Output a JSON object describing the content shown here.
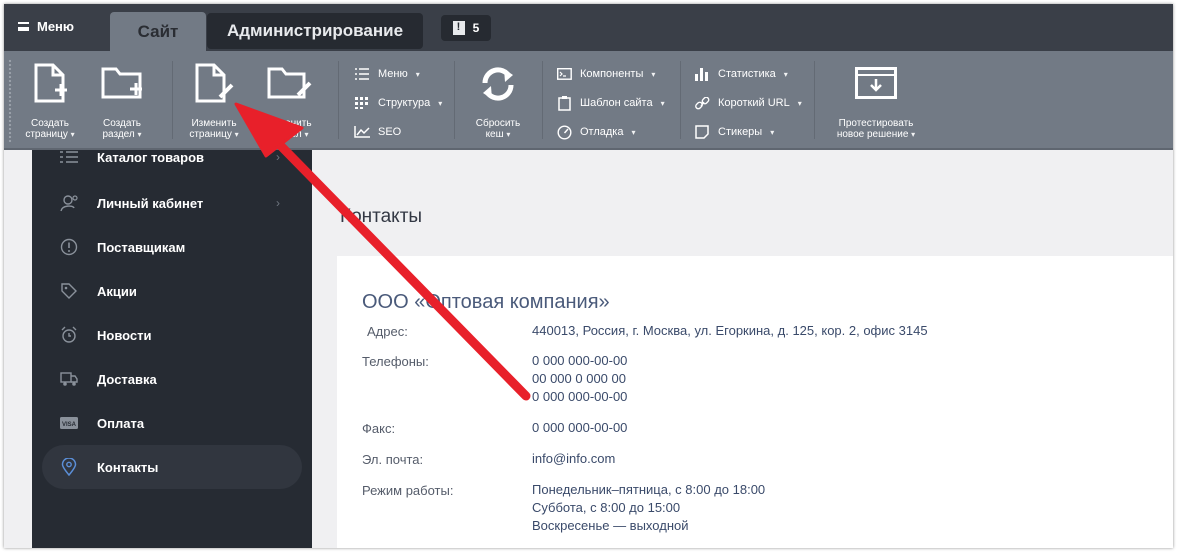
{
  "topbar": {
    "menu_label": "Меню",
    "tabs": [
      {
        "label": "Сайт",
        "active": true
      },
      {
        "label": "Администрирование",
        "active": false
      }
    ],
    "notifications_count": "5"
  },
  "toolbar": {
    "big_buttons": [
      {
        "line1": "Создать",
        "line2": "страницу",
        "icon": "create-page-icon"
      },
      {
        "line1": "Создать",
        "line2": "раздел",
        "icon": "create-section-icon"
      },
      {
        "line1": "Изменить",
        "line2": "страницу",
        "icon": "edit-page-icon"
      },
      {
        "line1": "Изменить",
        "line2": "раздел",
        "icon": "edit-section-icon"
      },
      {
        "line1": "Сбросить",
        "line2": "кеш",
        "icon": "refresh-icon"
      },
      {
        "line1": "Протестировать",
        "line2": "новое решение",
        "icon": "download-window-icon"
      }
    ],
    "group1": [
      {
        "label": "Меню",
        "icon": "list-icon",
        "has_caret": true
      },
      {
        "label": "Структура",
        "icon": "grid-icon",
        "has_caret": true
      },
      {
        "label": "SEO",
        "icon": "chart-icon",
        "has_caret": false
      }
    ],
    "group2": [
      {
        "label": "Компоненты",
        "icon": "terminal-icon"
      },
      {
        "label": "Шаблон сайта",
        "icon": "clipboard-icon"
      },
      {
        "label": "Отладка",
        "icon": "gauge-icon"
      }
    ],
    "group3": [
      {
        "label": "Статистика",
        "icon": "bar-chart-icon"
      },
      {
        "label": "Короткий URL",
        "icon": "link-icon"
      },
      {
        "label": "Стикеры",
        "icon": "sticker-icon"
      }
    ]
  },
  "sidebar": {
    "items": [
      {
        "label": "Каталог товаров",
        "icon": "catalog-list-icon",
        "chevron": true
      },
      {
        "label": "Личный кабинет",
        "icon": "user-gear-icon",
        "chevron": true
      },
      {
        "label": "Поставщикам",
        "icon": "info-circle-icon",
        "chevron": false
      },
      {
        "label": "Акции",
        "icon": "tag-icon",
        "chevron": false
      },
      {
        "label": "Новости",
        "icon": "alarm-icon",
        "chevron": false
      },
      {
        "label": "Доставка",
        "icon": "truck-icon",
        "chevron": false
      },
      {
        "label": "Оплата",
        "icon": "visa-icon",
        "chevron": false
      },
      {
        "label": "Контакты",
        "icon": "map-pin-icon",
        "chevron": false,
        "active": true
      }
    ]
  },
  "content": {
    "title": "Контакты",
    "company": "ООО «Оптовая компания»",
    "address_label": "Адрес:",
    "address": "440013, Россия, г. Москва, ул. Егоркина, д. 125, кор. 2, офис 3145",
    "phones_label": "Телефоны:",
    "phones": [
      "0 000 000-00-00",
      "00 000 0 000 00",
      "0 000 000-00-00"
    ],
    "fax_label": "Факс:",
    "fax": "0 000 000-00-00",
    "email_label": "Эл. почта:",
    "email": "info@info.com",
    "hours_label": "Режим работы:",
    "hours": [
      "Понедельник–пятница, с 8:00 до 18:00",
      "Суббота, с 8:00 до 15:00",
      "Воскресенье — выходной"
    ]
  },
  "colors": {
    "topbar": "#3a3f48",
    "toolbar": "#727a85",
    "sidebar": "#262b33",
    "accent_arrow": "#e8202a",
    "link": "#3a4a6a"
  }
}
